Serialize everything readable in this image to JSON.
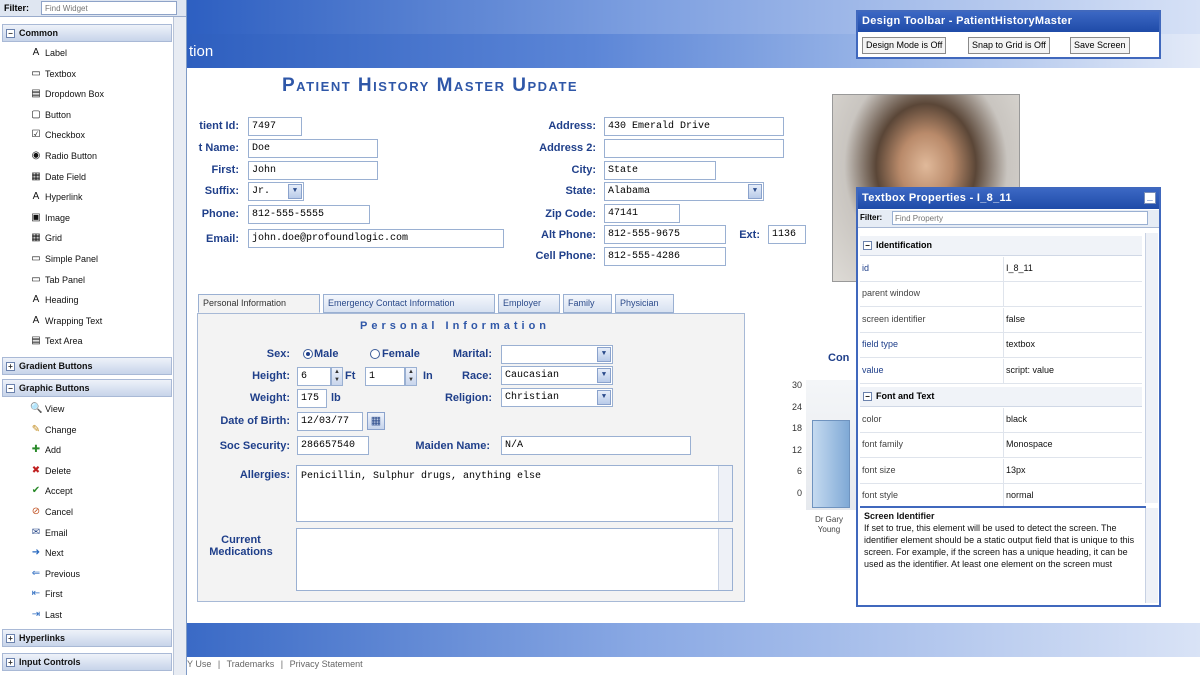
{
  "widget_panel": {
    "filter_label": "Filter:",
    "filter_placeholder": "Find Widget",
    "sections": {
      "common": "Common",
      "gradient": "Gradient Buttons",
      "graphic": "Graphic Buttons",
      "hyperlinks": "Hyperlinks",
      "input": "Input Controls"
    },
    "common_items": [
      "Label",
      "Textbox",
      "Dropdown Box",
      "Button",
      "Checkbox",
      "Radio Button",
      "Date Field",
      "Hyperlink",
      "Image",
      "Grid",
      "Simple Panel",
      "Tab Panel",
      "Heading",
      "Wrapping Text",
      "Text Area"
    ],
    "graphic_items": [
      "View",
      "Change",
      "Add",
      "Delete",
      "Accept",
      "Cancel",
      "Email",
      "Next",
      "Previous",
      "First",
      "Last"
    ]
  },
  "page": {
    "title_fragment": "tion",
    "heading": "Patient History Master Update",
    "footer": {
      "links": [
        "Y Use",
        "Trademarks",
        "Privacy Statement"
      ],
      "sep": "|"
    }
  },
  "form": {
    "patient_id": {
      "label": "tient Id:",
      "value": "7497"
    },
    "last_name": {
      "label": "t Name:",
      "value": "Doe"
    },
    "first": {
      "label": "First:",
      "value": "John"
    },
    "suffix": {
      "label": "Suffix:",
      "value": "Jr."
    },
    "phone": {
      "label": "Phone:",
      "value": "812-555-5555"
    },
    "email": {
      "label": "Email:",
      "value": "john.doe@profoundlogic.com"
    },
    "address": {
      "label": "Address:",
      "value": "430 Emerald Drive"
    },
    "address2": {
      "label": "Address 2:",
      "value": ""
    },
    "city": {
      "label": "City:",
      "value": "State"
    },
    "state": {
      "label": "State:",
      "value": "Alabama"
    },
    "zip": {
      "label": "Zip Code:",
      "value": "47141"
    },
    "alt_phone": {
      "label": "Alt Phone:",
      "value": "812-555-9675"
    },
    "ext": {
      "label": "Ext:",
      "value": "1136"
    },
    "cell_phone": {
      "label": "Cell Phone:",
      "value": "812-555-4286"
    }
  },
  "tabs": [
    "Personal Information",
    "Emergency Contact Information",
    "Employer",
    "Family",
    "Physician"
  ],
  "personal": {
    "section_title": "Personal Information",
    "sex_label": "Sex:",
    "male": "Male",
    "female": "Female",
    "marital_label": "Marital:",
    "marital_value": "",
    "height_label": "Height:",
    "height_ft": "6",
    "ft_unit": "Ft",
    "height_in": "1",
    "in_unit": "In",
    "race_label": "Race:",
    "race_value": "Caucasian",
    "weight_label": "Weight:",
    "weight_value": "175",
    "weight_unit": "lb",
    "religion_label": "Religion:",
    "religion_value": "Christian",
    "dob_label": "Date of Birth:",
    "dob_value": "12/03/77",
    "ssn_label": "Soc Security:",
    "ssn_value": "286657540",
    "maiden_label": "Maiden Name:",
    "maiden_value": "N/A",
    "allergies_label": "Allergies:",
    "allergies_value": "Penicillin, Sulphur drugs, anything else",
    "meds_label_1": "Current",
    "meds_label_2": "Medications",
    "meds_value": ""
  },
  "chart_side": {
    "label_fragment": "Con",
    "y_ticks": [
      "30",
      "24",
      "18",
      "12",
      "6",
      "0"
    ],
    "x_label_1": "Dr Gary",
    "x_label_2": "Young"
  },
  "design_toolbar": {
    "title": "Design Toolbar - PatientHistoryMaster",
    "buttons": [
      "Design Mode is Off",
      "Snap to Grid is Off",
      "Save Screen"
    ]
  },
  "properties": {
    "title": "Textbox Properties - I_8_11",
    "filter_label": "Filter:",
    "filter_placeholder": "Find Property",
    "group1": "Identification",
    "group2": "Font and Text",
    "rows1": [
      {
        "k": "id",
        "v": "I_8_11"
      },
      {
        "k": "parent window",
        "v": ""
      },
      {
        "k": "screen identifier",
        "v": "false"
      },
      {
        "k": "field type",
        "v": "textbox"
      },
      {
        "k": "value",
        "v": "script: value"
      }
    ],
    "rows2": [
      {
        "k": "color",
        "v": "black"
      },
      {
        "k": "font family",
        "v": "Monospace"
      },
      {
        "k": "font size",
        "v": "13px"
      },
      {
        "k": "font style",
        "v": "normal"
      }
    ],
    "help_title": "Screen Identifier",
    "help_text": "If set to true, this element will be used to detect the screen. The identifier element should be a static output field that is unique to this screen. For example, if the screen has a unique heading, it can be used as the identifier. At least one element on the screen must"
  }
}
